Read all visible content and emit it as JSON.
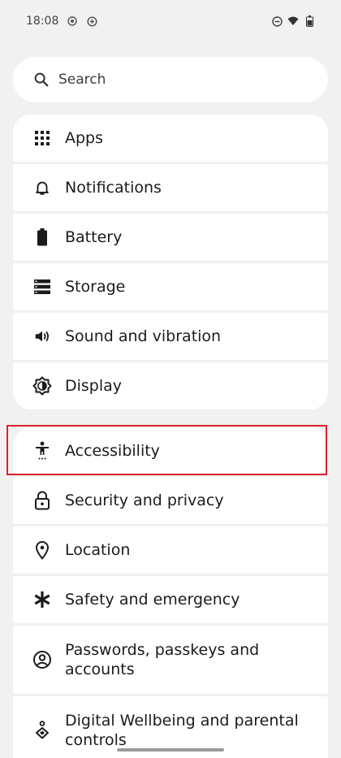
{
  "status_bar": {
    "time": "18:08"
  },
  "search": {
    "placeholder": "Search"
  },
  "settings_groups": [
    {
      "items": [
        {
          "label": "Apps",
          "icon": "apps-grid-icon"
        },
        {
          "label": "Notifications",
          "icon": "bell-icon"
        },
        {
          "label": "Battery",
          "icon": "battery-icon"
        },
        {
          "label": "Storage",
          "icon": "storage-icon"
        },
        {
          "label": "Sound and vibration",
          "icon": "volume-icon"
        },
        {
          "label": "Display",
          "icon": "brightness-icon"
        }
      ]
    },
    {
      "items": [
        {
          "label": "Accessibility",
          "icon": "accessibility-icon"
        },
        {
          "label": "Security and privacy",
          "icon": "lock-icon"
        },
        {
          "label": "Location",
          "icon": "location-pin-icon"
        },
        {
          "label": "Safety and emergency",
          "icon": "asterisk-icon"
        },
        {
          "label": "Passwords, passkeys and accounts",
          "icon": "account-circle-icon"
        },
        {
          "label": "Digital Wellbeing and parental controls",
          "icon": "wellbeing-icon"
        }
      ]
    }
  ],
  "colors": {
    "background": "#f1f1f1",
    "card": "#ffffff",
    "highlight": "#d9232d"
  }
}
